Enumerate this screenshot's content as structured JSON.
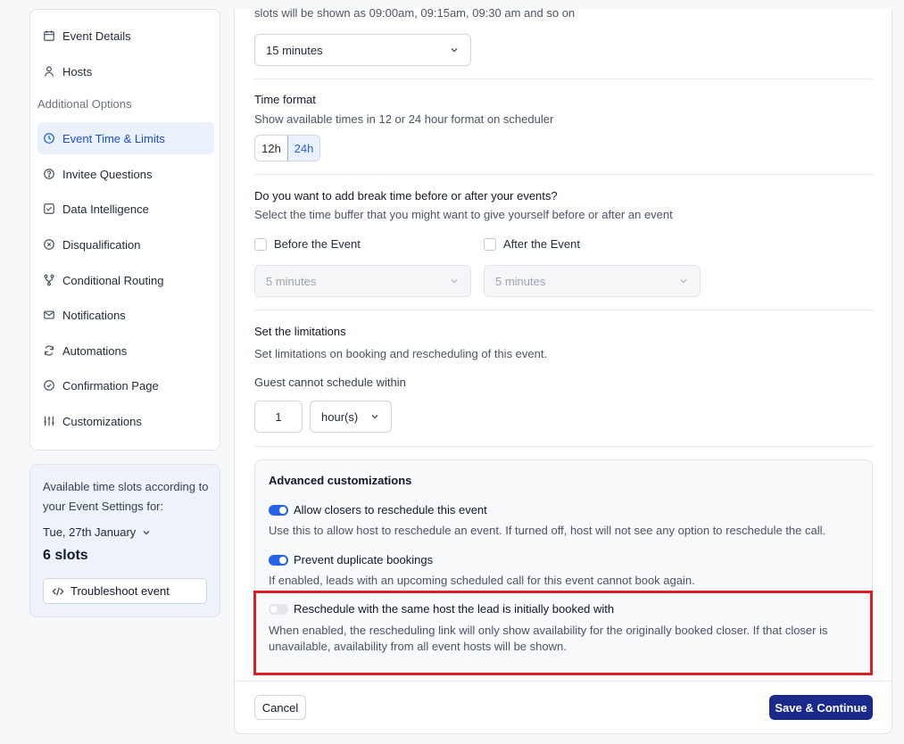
{
  "sidebar": {
    "items": [
      {
        "label": "Event Details",
        "icon": "calendar-icon"
      },
      {
        "label": "Hosts",
        "icon": "user-icon"
      },
      {
        "label": "Event Time & Limits",
        "icon": "clock-icon",
        "active": true
      },
      {
        "label": "Invitee Questions",
        "icon": "question-circle-icon"
      },
      {
        "label": "Data Intelligence",
        "icon": "check-square-icon"
      },
      {
        "label": "Disqualification",
        "icon": "x-circle-icon"
      },
      {
        "label": "Conditional Routing",
        "icon": "branch-icon"
      },
      {
        "label": "Notifications",
        "icon": "mail-icon"
      },
      {
        "label": "Automations",
        "icon": "refresh-icon"
      },
      {
        "label": "Confirmation Page",
        "icon": "check-circle-icon"
      },
      {
        "label": "Customizations",
        "icon": "sliders-icon"
      }
    ],
    "section_heading": "Additional Options"
  },
  "slots": {
    "description": "Available time slots according to your Event Settings for:",
    "date": "Tue, 27th January",
    "count": "6 slots",
    "troubleshoot_label": "Troubleshoot event"
  },
  "main": {
    "interval_hint": "slots will be shown as 09:00am, 09:15am, 09:30 am and so on",
    "interval_value": "15 minutes",
    "time_format": {
      "title": "Time format",
      "subtitle": "Show available times in 12 or 24 hour format on scheduler",
      "options": [
        "12h",
        "24h"
      ],
      "selected": "24h"
    },
    "break_time": {
      "title": "Do you want to add break time before or after your events?",
      "subtitle": "Select the time buffer that you might want to give yourself before or after an event",
      "before_label": "Before the Event",
      "after_label": "After the Event",
      "before_value": "5 minutes",
      "after_value": "5 minutes"
    },
    "limitations": {
      "title": "Set the limitations",
      "subtitle": "Set limitations on booking and rescheduling of this event.",
      "guest_label": "Guest cannot schedule within",
      "guest_value": "1",
      "unit_value": "hour(s)"
    },
    "advanced": {
      "title": "Advanced customizations",
      "options": [
        {
          "label": "Allow closers to reschedule this event",
          "desc": "Use this to allow host to reschedule an event. If turned off, host will not see any option to reschedule the call.",
          "enabled": true
        },
        {
          "label": "Prevent duplicate bookings",
          "desc": "If enabled, leads with an upcoming scheduled call for this event cannot book again.",
          "enabled": true
        },
        {
          "label": "Reschedule with the same host the lead is initially booked with",
          "desc_line1": "When enabled, the rescheduling link will only show availability for the originally booked closer. If that closer is",
          "desc_line2": "unavailable, availability from all event hosts will be shown.",
          "enabled": false
        }
      ]
    }
  },
  "footer": {
    "cancel_label": "Cancel",
    "save_label": "Save & Continue"
  },
  "colors": {
    "accent": "#2563eb",
    "save_button": "#1a2a8c",
    "highlight": "#dc1f26"
  }
}
